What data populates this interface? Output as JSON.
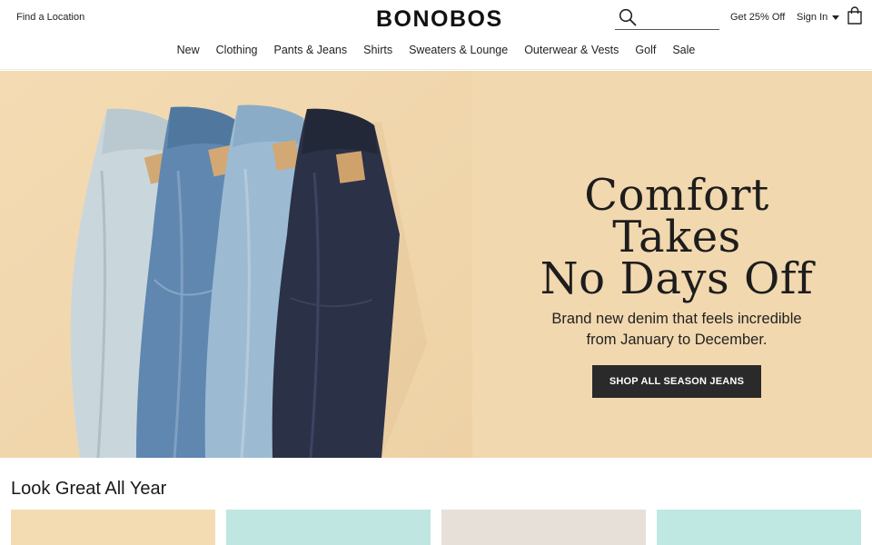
{
  "topbar": {
    "find_location": "Find a Location",
    "logo": "BONOBOS",
    "search": {
      "placeholder": "",
      "value": ""
    },
    "promo": "Get 25% Off",
    "sign_in": "Sign In"
  },
  "nav": {
    "items": [
      {
        "label": "New"
      },
      {
        "label": "Clothing"
      },
      {
        "label": "Pants & Jeans"
      },
      {
        "label": "Shirts"
      },
      {
        "label": "Sweaters & Lounge"
      },
      {
        "label": "Outerwear & Vests"
      },
      {
        "label": "Golf"
      },
      {
        "label": "Sale"
      }
    ]
  },
  "hero": {
    "title_line1": "Comfort Takes",
    "title_line2": "No Days Off",
    "subtitle": "Brand new denim that feels incredible from January to December.",
    "cta": "SHOP ALL SEASON JEANS",
    "background_color": "#f2d8af"
  },
  "section": {
    "title": "Look Great All Year",
    "tiles": [
      {
        "color": "#f3dcb2"
      },
      {
        "color": "#bfe6e0"
      },
      {
        "color": "#e6e0d9"
      },
      {
        "color": "#bfe8e2"
      }
    ]
  },
  "icons": {
    "search": "search-icon",
    "bag": "shopping-bag-icon",
    "caret": "chevron-down-icon"
  }
}
